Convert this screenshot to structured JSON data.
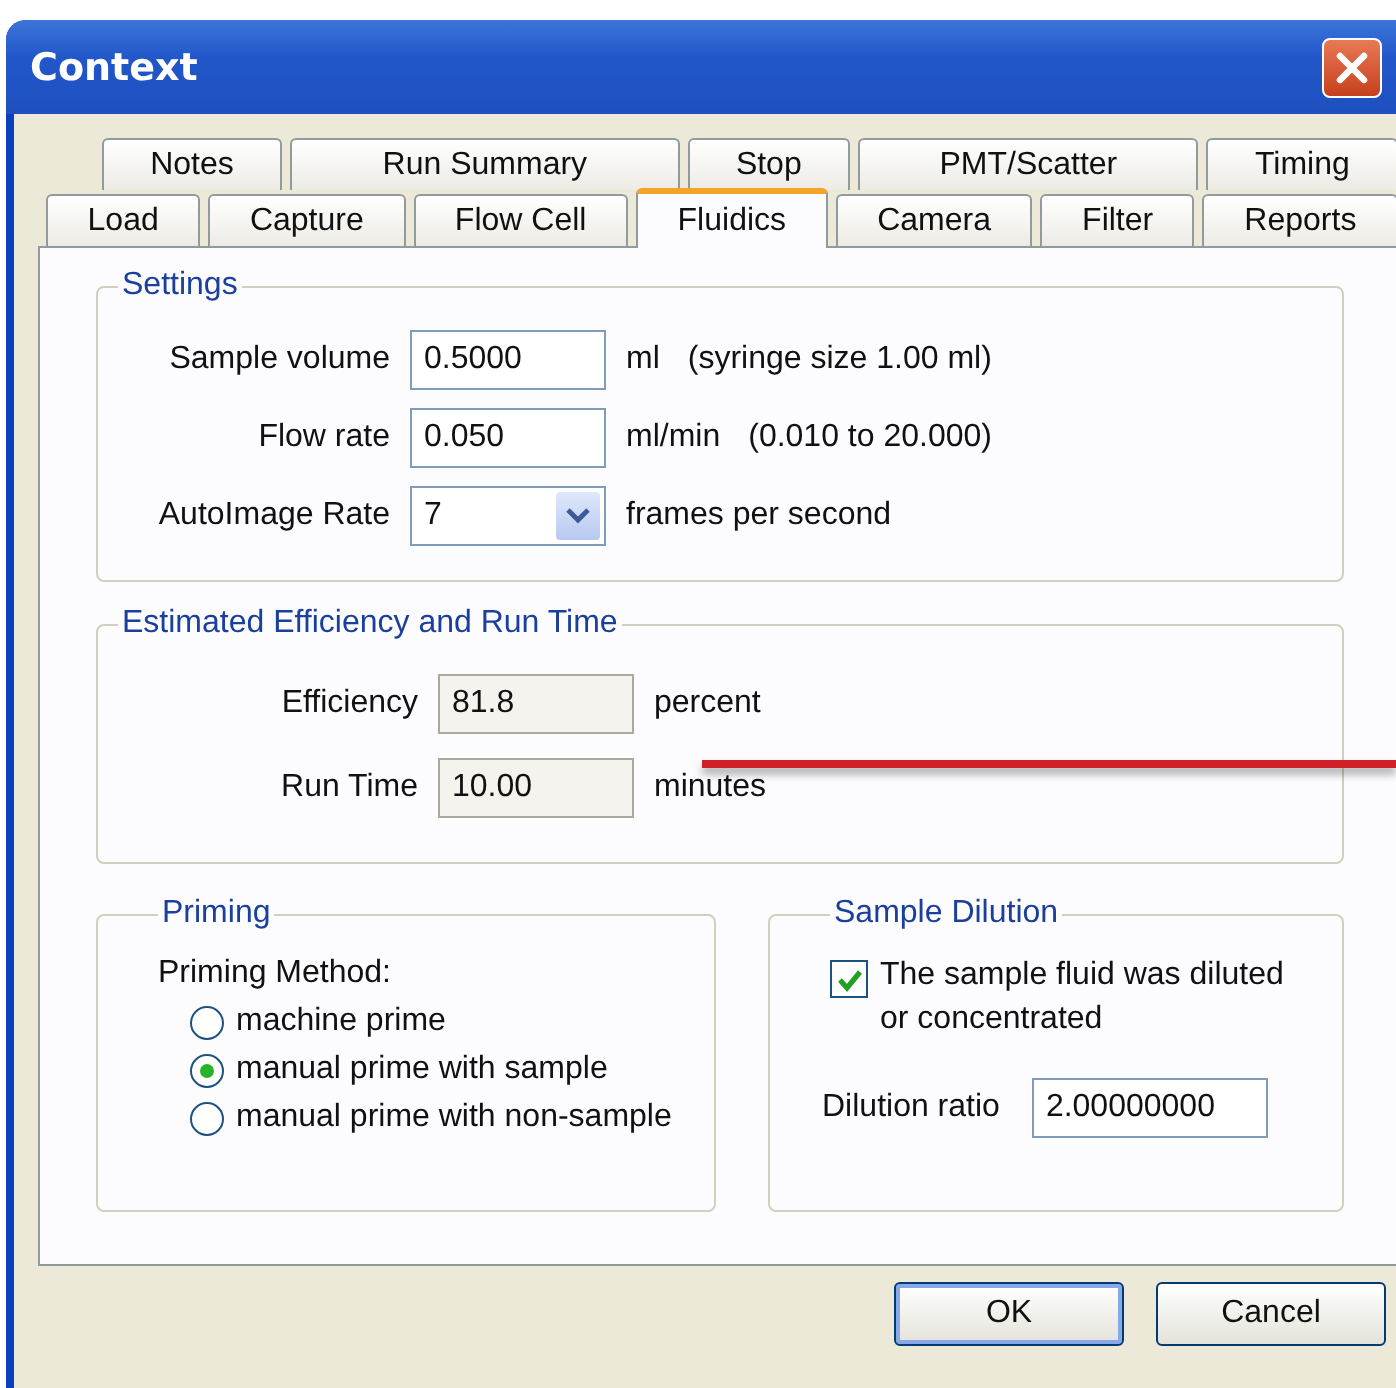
{
  "window": {
    "title": "Context"
  },
  "tab_rows": [
    [
      {
        "label": "Notes",
        "selected": false
      },
      {
        "label": "Run Summary",
        "selected": false
      },
      {
        "label": "Stop",
        "selected": false
      },
      {
        "label": "PMT/Scatter",
        "selected": false
      },
      {
        "label": "Timing",
        "selected": false
      }
    ],
    [
      {
        "label": "Load",
        "selected": false
      },
      {
        "label": "Capture",
        "selected": false
      },
      {
        "label": "Flow Cell",
        "selected": false
      },
      {
        "label": "Fluidics",
        "selected": true
      },
      {
        "label": "Camera",
        "selected": false
      },
      {
        "label": "Filter",
        "selected": false
      },
      {
        "label": "Reports",
        "selected": false
      }
    ]
  ],
  "settings": {
    "title": "Settings",
    "fields": [
      {
        "kind": "text",
        "label": "Sample volume",
        "value": "0.5000",
        "unit": "ml",
        "note": "(syringe size 1.00 ml)"
      },
      {
        "kind": "text",
        "label": "Flow rate",
        "value": "0.050",
        "unit": "ml/min",
        "note": "(0.010  to  20.000)"
      },
      {
        "kind": "dropdown",
        "label": "AutoImage Rate",
        "value": "7",
        "unit": "frames per second"
      }
    ]
  },
  "estimate": {
    "title": "Estimated Efficiency and Run Time",
    "fields": [
      {
        "kind": "readout",
        "label": "Efficiency",
        "value": "81.8",
        "unit": "percent"
      },
      {
        "kind": "readout",
        "label": "Run Time",
        "value": "10.00",
        "unit": "minutes"
      }
    ]
  },
  "priming": {
    "title": "Priming",
    "label": "Priming Method:",
    "options": [
      {
        "label": "machine prime",
        "selected": false
      },
      {
        "label": "manual prime with sample",
        "selected": true
      },
      {
        "label": "manual prime with non-sample",
        "selected": false
      }
    ]
  },
  "dilution": {
    "title": "Sample Dilution",
    "checkbox": {
      "label": "The sample fluid was diluted or concentrated",
      "checked": true
    },
    "ratio_label": "Dilution ratio",
    "ratio_value": "2.00000000"
  },
  "buttons": [
    {
      "label": "OK",
      "default": true
    },
    {
      "label": "Cancel",
      "default": false
    }
  ]
}
